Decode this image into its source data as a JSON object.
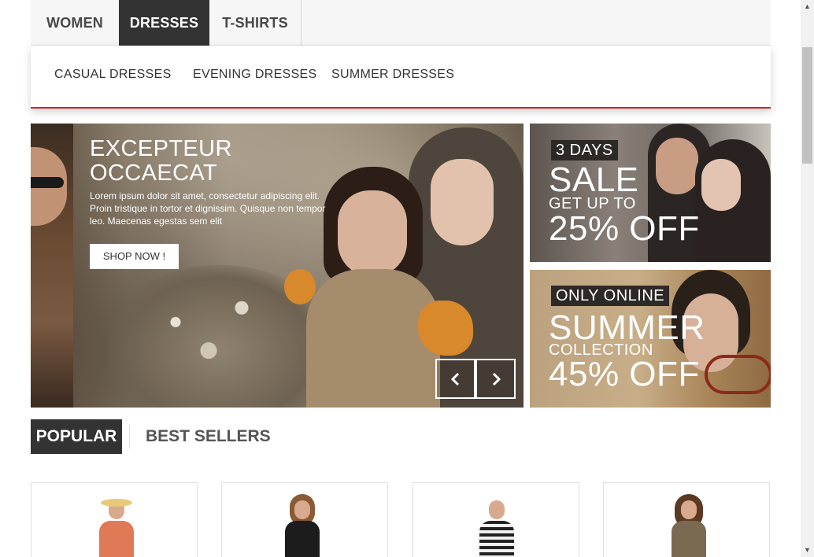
{
  "top_menu": {
    "items": [
      {
        "label": "WOMEN"
      },
      {
        "label": "DRESSES",
        "active": true
      },
      {
        "label": "T-SHIRTS"
      }
    ]
  },
  "submenu": {
    "items": [
      {
        "label": "CASUAL DRESSES"
      },
      {
        "label": "EVENING DRESSES"
      },
      {
        "label": "SUMMER DRESSES"
      }
    ],
    "accent_color": "#c6262e"
  },
  "slider": {
    "title": "EXCEPTEUR OCCAECAT",
    "text": "Lorem ipsum dolor sit amet, consectetur adipiscing elit. Proin tristique in tortor et dignissim. Quisque non tempor leo. Maecenas egestas sem elit",
    "button_label": "SHOP NOW !",
    "prev_icon": "chevron-left-icon",
    "next_icon": "chevron-right-icon"
  },
  "banners": {
    "sale": {
      "tag": "3 DAYS",
      "headline": "SALE",
      "subline": "GET UP TO",
      "offer": "25% OFF"
    },
    "summer": {
      "tag": "ONLY ONLINE",
      "headline": "SUMMER",
      "subline": "COLLECTION",
      "offer": "45% OFF"
    }
  },
  "product_tabs": {
    "items": [
      {
        "label": "POPULAR",
        "active": true
      },
      {
        "label": "BEST SELLERS"
      }
    ]
  },
  "products": [
    {
      "image": "woman-in-coral-dress-with-straw-hat"
    },
    {
      "image": "woman-in-black-top"
    },
    {
      "image": "woman-in-striped-top"
    },
    {
      "image": "woman-in-printed-dress"
    }
  ],
  "colors": {
    "dark": "#333333",
    "accent": "#c6262e"
  }
}
